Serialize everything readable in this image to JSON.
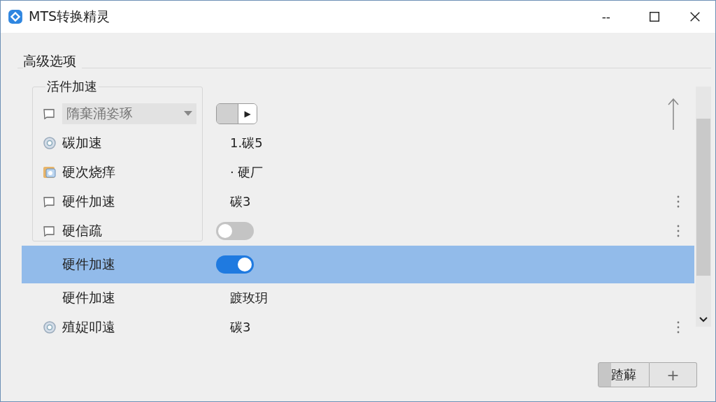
{
  "window": {
    "title": "MTS转换精灵",
    "controls": [
      "--"
    ]
  },
  "section": {
    "title": "高级选项"
  },
  "group": {
    "title": "活件加速"
  },
  "rows": [
    {
      "kind": "checkbox",
      "label": "隋棄涌姿琢",
      "control": {
        "kind": "dropdown"
      },
      "value": {
        "kind": "spin",
        "text": "▶"
      },
      "selected": false
    },
    {
      "kind": "gear",
      "label": "碳加速",
      "value": {
        "kind": "text",
        "text": "1.碳5"
      },
      "selected": false
    },
    {
      "kind": "image",
      "label": "硬次烧痒",
      "value": {
        "kind": "text",
        "text": "· 硬厂"
      },
      "selected": false
    },
    {
      "kind": "checkbox",
      "label": "硬件加速",
      "value": {
        "kind": "text",
        "text": "碳3"
      },
      "selected": false
    },
    {
      "kind": "checkbox",
      "label": "硬信疏",
      "value": {
        "kind": "toggle",
        "on": false
      },
      "selected": false
    },
    {
      "kind": "plain",
      "label": "硬件加速",
      "value": {
        "kind": "toggle",
        "on": true
      },
      "selected": true
    },
    {
      "kind": "plain",
      "label": "硬件加速",
      "value": {
        "kind": "text",
        "text": "踱玫玥"
      },
      "selected": false
    },
    {
      "kind": "gear",
      "label": "殖娖叩遠",
      "value": {
        "kind": "text",
        "text": "碳3"
      },
      "selected": false
    }
  ],
  "buttons": [
    {
      "label": "蹅薢"
    },
    {
      "label": "+"
    }
  ]
}
